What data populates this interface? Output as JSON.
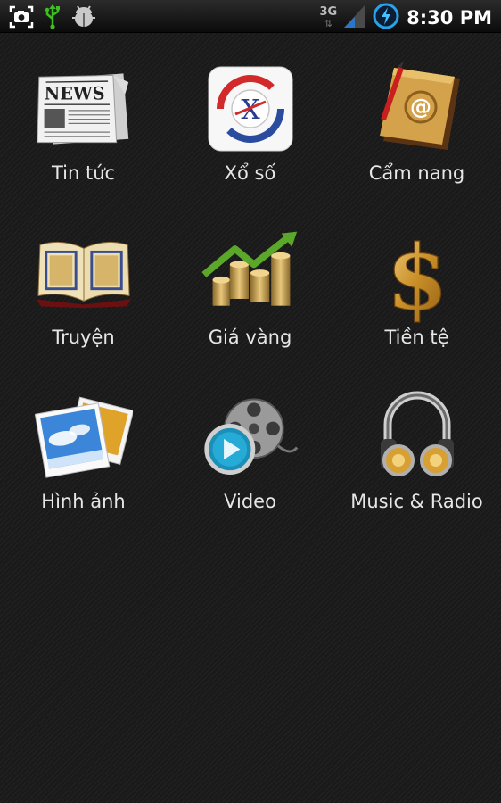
{
  "status_bar": {
    "time": "8:30 PM",
    "network_type": "3G",
    "left_icons": [
      "screenshot-icon",
      "usb-icon",
      "debug-bug-icon"
    ],
    "right_icons": [
      "signal-strength-icon",
      "battery-charging-icon"
    ]
  },
  "apps": [
    {
      "label": "Tin tức",
      "icon": "newspaper-icon"
    },
    {
      "label": "Xổ số",
      "icon": "lottery-x-icon"
    },
    {
      "label": "Cẩm nang",
      "icon": "address-book-icon"
    },
    {
      "label": "Truyện",
      "icon": "open-book-icon"
    },
    {
      "label": "Giá vàng",
      "icon": "gold-coins-chart-icon"
    },
    {
      "label": "Tiền tệ",
      "icon": "dollar-sign-icon"
    },
    {
      "label": "Hình ảnh",
      "icon": "photos-icon"
    },
    {
      "label": "Video",
      "icon": "film-reel-icon"
    },
    {
      "label": "Music & Radio",
      "icon": "headphones-icon"
    }
  ],
  "icon_text": {
    "news_masthead": "NEWS"
  }
}
